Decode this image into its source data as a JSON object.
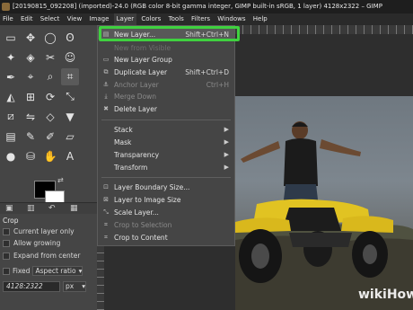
{
  "window": {
    "title": "[20190815_092208] (imported)-24.0 (RGB color 8-bit gamma integer, GIMP built-in sRGB, 1 layer) 4128x2322 – GIMP"
  },
  "menubar": {
    "items": [
      "File",
      "Edit",
      "Select",
      "View",
      "Image",
      "Layer",
      "Colors",
      "Tools",
      "Filters",
      "Windows",
      "Help"
    ],
    "active": "Layer"
  },
  "layer_menu": {
    "items": [
      {
        "label": "New Layer...",
        "shortcut": "Shift+Ctrl+N",
        "icon": "new-layer-icon",
        "enabled": true,
        "highlighted": true
      },
      {
        "label": "New from Visible",
        "shortcut": "",
        "icon": "new-visible-icon",
        "enabled": true
      },
      {
        "label": "New Layer Group",
        "shortcut": "",
        "icon": "layer-group-icon",
        "enabled": true
      },
      {
        "label": "Duplicate Layer",
        "shortcut": "Shift+Ctrl+D",
        "icon": "duplicate-icon",
        "enabled": true
      },
      {
        "label": "Anchor Layer",
        "shortcut": "Ctrl+H",
        "icon": "anchor-icon",
        "enabled": false
      },
      {
        "label": "Merge Down",
        "shortcut": "",
        "icon": "merge-icon",
        "enabled": false
      },
      {
        "label": "Delete Layer",
        "shortcut": "",
        "icon": "delete-icon",
        "enabled": true
      },
      {
        "label": "Stack",
        "submenu": true,
        "enabled": true
      },
      {
        "label": "Mask",
        "submenu": true,
        "enabled": true
      },
      {
        "label": "Transparency",
        "submenu": true,
        "enabled": true
      },
      {
        "label": "Transform",
        "submenu": true,
        "enabled": true
      },
      {
        "label": "Layer Boundary Size...",
        "icon": "boundary-icon",
        "enabled": true
      },
      {
        "label": "Layer to Image Size",
        "icon": "to-image-icon",
        "enabled": true
      },
      {
        "label": "Scale Layer...",
        "icon": "scale-icon",
        "enabled": true
      },
      {
        "label": "Crop to Selection",
        "icon": "crop-sel-icon",
        "enabled": false
      },
      {
        "label": "Crop to Content",
        "icon": "crop-content-icon",
        "enabled": true
      }
    ]
  },
  "tool_options": {
    "title": "Crop",
    "current_layer_only": "Current layer only",
    "allow_growing": "Allow growing",
    "expand_from_center": "Expand from center",
    "fixed_label": "Fixed",
    "fixed_mode": "Aspect ratio",
    "ratio_value": "4128:2322",
    "unit": "px"
  },
  "colors": {
    "accent_highlight": "#3fd13f",
    "foreground": "#000000",
    "background": "#ffffff"
  },
  "watermark": "wikiHow"
}
